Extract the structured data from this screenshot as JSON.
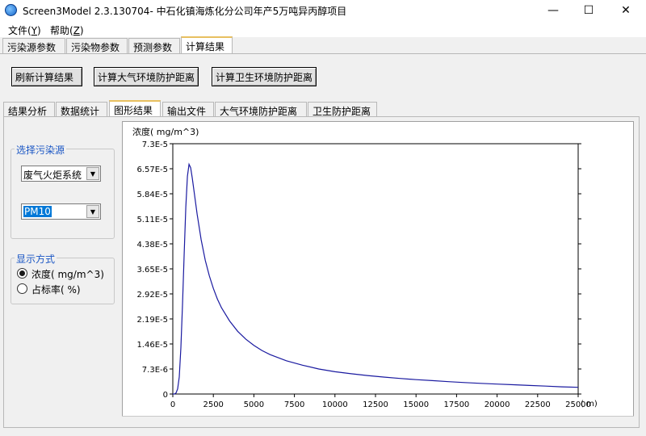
{
  "window": {
    "title": "Screen3Model 2.3.130704- 中石化镇海炼化分公司年产5万吨异丙醇项目",
    "minimize": "—",
    "maximize": "☐",
    "close": "✕"
  },
  "menu": {
    "file": "文件(",
    "file_key": "Y",
    "file_end": ")",
    "help": "帮助(",
    "help_key": "Z",
    "help_end": ")"
  },
  "top_tabs": [
    "污染源参数",
    "污染物参数",
    "预测参数",
    "计算结果"
  ],
  "buttons": {
    "refresh": "刷新计算结果",
    "atmos_distance": "计算大气环境防护距离",
    "health_distance": "计算卫生环境防护距离"
  },
  "sub_tabs": [
    "结果分析",
    "数据统计",
    "图形结果",
    "输出文件",
    "大气环境防护距离",
    "卫生防护距离"
  ],
  "source_group": {
    "legend": "选择污染源",
    "source_value": "废气火炬系统",
    "pollutant_value": "PM10"
  },
  "display_group": {
    "legend": "显示方式",
    "options": [
      "浓度( mg/m^3)",
      "占标率( %)"
    ],
    "selected": 0
  },
  "chart_data": {
    "type": "line",
    "ylabel": "浓度( mg/m^3)",
    "xlabel": "( m)",
    "xlim": [
      0,
      25000
    ],
    "ylim": [
      0,
      7.3e-05
    ],
    "x_ticks": [
      "0",
      "2500",
      "5000",
      "7500",
      "10000",
      "12500",
      "15000",
      "17500",
      "20000",
      "22500",
      "25000"
    ],
    "y_ticks": [
      "0",
      "7.3E-6",
      "1.46E-5",
      "2.19E-5",
      "2.92E-5",
      "3.65E-5",
      "4.38E-5",
      "5.11E-5",
      "5.84E-5",
      "6.57E-5",
      "7.3E-5"
    ],
    "line_color": "#1a1aa0",
    "series": [
      {
        "x": [
          0,
          50,
          100,
          200,
          300,
          400,
          500,
          600,
          700,
          800,
          900,
          1000,
          1100,
          1200,
          1300,
          1400,
          1500,
          1750,
          2000,
          2250,
          2500,
          2750,
          3000,
          3500,
          4000,
          4500,
          5000,
          5500,
          6000,
          7000,
          8000,
          9000,
          10000,
          11000,
          12000,
          13000,
          14000,
          15000,
          16000,
          17000,
          18000,
          19000,
          20000,
          21000,
          22000,
          23000,
          24000,
          25000
        ],
        "y": [
          0,
          0,
          0.0,
          3e-07,
          1.5e-06,
          5e-06,
          1.35e-05,
          2.6e-05,
          4.1e-05,
          5.45e-05,
          6.35e-05,
          6.7e-05,
          6.6e-05,
          6.3e-05,
          5.95e-05,
          5.6e-05,
          5.25e-05,
          4.5e-05,
          3.9e-05,
          3.45e-05,
          3.08e-05,
          2.77e-05,
          2.52e-05,
          2.13e-05,
          1.83e-05,
          1.6e-05,
          1.42e-05,
          1.27e-05,
          1.15e-05,
          9.7e-06,
          8.4e-06,
          7.3e-06,
          6.5e-06,
          5.9e-06,
          5.4e-06,
          4.95e-06,
          4.55e-06,
          4.2e-06,
          3.9e-06,
          3.6e-06,
          3.35e-06,
          3.1e-06,
          2.9e-06,
          2.7e-06,
          2.5e-06,
          2.3e-06,
          2.1e-06,
          1.95e-06
        ]
      }
    ]
  }
}
